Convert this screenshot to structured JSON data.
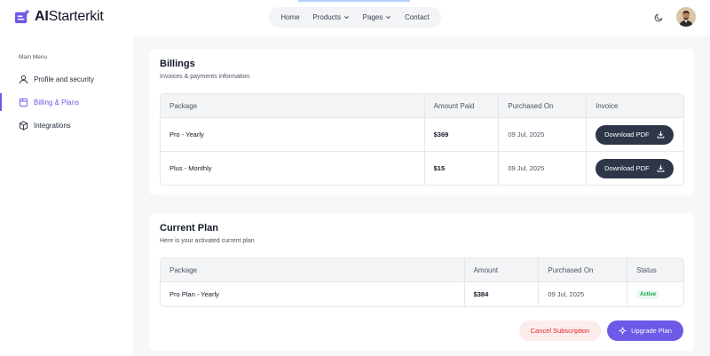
{
  "brand": {
    "name_bold": "AI",
    "name_rest": "Starterkit",
    "accent_color": "#6d5ae6"
  },
  "nav": {
    "items": [
      {
        "label": "Home"
      },
      {
        "label": "Products"
      },
      {
        "label": "Pages"
      },
      {
        "label": "Contact"
      }
    ]
  },
  "header": {
    "theme_icon": "moon-icon",
    "avatar_icon": "avatar"
  },
  "sidebar": {
    "heading": "Main Menu",
    "items": [
      {
        "label": "Profile and security",
        "icon": "user-icon"
      },
      {
        "label": "Billing & Plans",
        "icon": "billing-icon"
      },
      {
        "label": "Integrations",
        "icon": "cube-icon"
      }
    ]
  },
  "billings": {
    "title": "Billings",
    "subtitle": "Invoices & payments information",
    "columns": [
      "Package",
      "Amount Paid",
      "Purchased On",
      "Invoice"
    ],
    "rows": [
      {
        "package": "Pro - Yearly",
        "amount": "$369",
        "date": "09 Jul, 2025",
        "action": "Download PDF"
      },
      {
        "package": "Plus - Monthly",
        "amount": "$15",
        "date": "09 Jul, 2025",
        "action": "Download PDF"
      }
    ]
  },
  "current_plan": {
    "title": "Current Plan",
    "subtitle": "Here is your activated current plan",
    "columns": [
      "Package",
      "Amount",
      "Purchased On",
      "Status"
    ],
    "rows": [
      {
        "package": "Pro Plan - Yearly",
        "amount": "$384",
        "date": "09 Jul, 2025",
        "status": "Active"
      }
    ],
    "cancel_label": "Cancel Subscription",
    "upgrade_label": "Upgrade Plan"
  }
}
